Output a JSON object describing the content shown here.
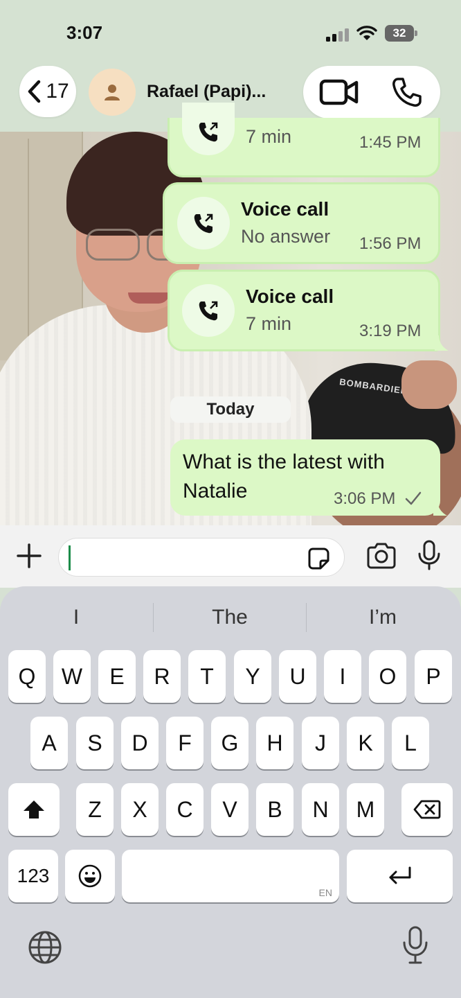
{
  "status_bar": {
    "time": "3:07",
    "battery": "32"
  },
  "header": {
    "back_count": "17",
    "contact_name": "Rafael (Papi)..."
  },
  "messages": {
    "partial_call": {
      "subtitle": "7 min",
      "time": "1:45 PM"
    },
    "call_2": {
      "title": "Voice call",
      "subtitle": "No answer",
      "time": "1:56 PM"
    },
    "call_3": {
      "title": "Voice call",
      "subtitle": "7 min",
      "time": "3:19 PM"
    },
    "day_separator": "Today",
    "text_message": {
      "text": "What is the latest with Natalie",
      "time": "3:06 PM"
    }
  },
  "background_photo": {
    "cap_text": "BOMBARDIER"
  },
  "input": {
    "value": "",
    "placeholder": ""
  },
  "keyboard": {
    "suggestions": [
      "I",
      "The",
      "I’m"
    ],
    "row1": [
      "Q",
      "W",
      "E",
      "R",
      "T",
      "Y",
      "U",
      "I",
      "O",
      "P"
    ],
    "row2": [
      "A",
      "S",
      "D",
      "F",
      "G",
      "H",
      "J",
      "K",
      "L"
    ],
    "row3": [
      "Z",
      "X",
      "C",
      "V",
      "B",
      "N",
      "M"
    ],
    "numbers_key": "123",
    "space_lang": "EN"
  },
  "colors": {
    "header_bg": "#d5e2d2",
    "bubble_bg": "#dcf8c6",
    "caret": "#1c8c4a",
    "keyboard_bg": "#d3d5db"
  },
  "icons": {
    "back": "chevron-left-icon",
    "avatar": "person-icon",
    "video": "video-camera-icon",
    "phone": "phone-icon",
    "outgoing_call": "outgoing-call-icon",
    "sticker": "sticker-icon",
    "camera": "camera-icon",
    "mic": "microphone-icon",
    "plus": "plus-icon",
    "shift": "shift-icon",
    "delete": "backspace-icon",
    "emoji": "emoji-icon",
    "return": "return-icon",
    "globe": "globe-icon"
  }
}
